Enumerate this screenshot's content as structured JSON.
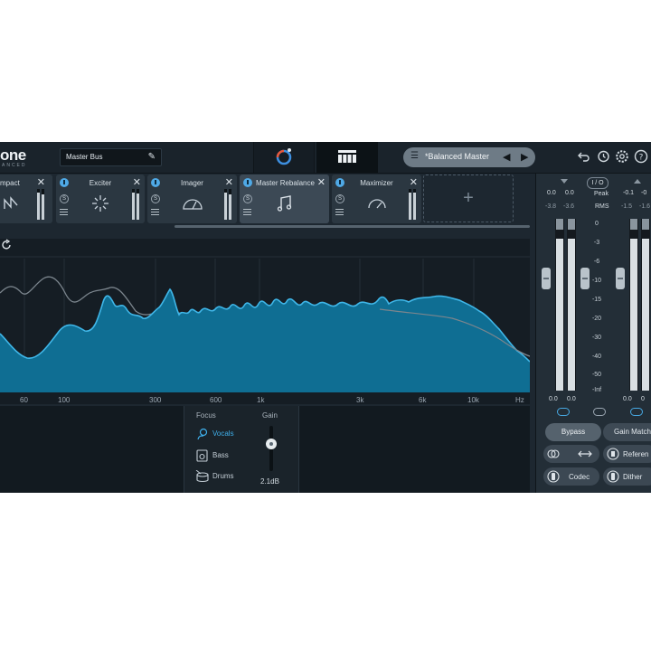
{
  "header": {
    "logo_text": "one",
    "logo_subtext": "ANCED",
    "preset_name": "Master Bus",
    "preset_selector": "*Balanced Master",
    "icons": [
      "edit-icon",
      "assistant-icon",
      "modules-grid-icon",
      "list-icon",
      "prev-icon",
      "next-icon",
      "undo-icon",
      "history-icon",
      "settings-icon",
      "help-icon"
    ]
  },
  "modules": [
    {
      "name": "mpact",
      "icon": "impact-icon"
    },
    {
      "name": "Exciter",
      "icon": "exciter-icon"
    },
    {
      "name": "Imager",
      "icon": "imager-icon"
    },
    {
      "name": "Master Rebalance",
      "icon": "rebalance-icon",
      "active": true
    },
    {
      "name": "Maximizer",
      "icon": "maximizer-icon"
    }
  ],
  "add_module": "+",
  "spectrum": {
    "freq_labels": [
      "60",
      "100",
      "300",
      "600",
      "1k",
      "3k",
      "6k",
      "10k",
      "Hz"
    ]
  },
  "rebalance": {
    "focus_label": "Focus",
    "gain_label": "Gain",
    "focus_options": [
      {
        "label": "Vocals",
        "selected": true
      },
      {
        "label": "Bass",
        "selected": false
      },
      {
        "label": "Drums",
        "selected": false
      }
    ],
    "gain_value": "2.1dB",
    "gain_fraction": 0.6
  },
  "meters": {
    "io_label": "I / O",
    "peak_label": "Peak",
    "rms_label": "RMS",
    "input_peak": [
      "0.0",
      "0.0"
    ],
    "input_rms": [
      "-3.8",
      "-3.6"
    ],
    "output_peak": [
      "-0.1",
      "-0"
    ],
    "output_rms": [
      "-1.5",
      "-1.6"
    ],
    "scale": [
      "0",
      "-3",
      "-6",
      "-10",
      "-15",
      "-20",
      "-30",
      "-40",
      "-50",
      "-Inf"
    ],
    "input_bottom": [
      "0.0",
      "0.0"
    ],
    "output_bottom": [
      "0.0",
      "0"
    ],
    "bypass": "Bypass",
    "gain_match": "Gain Match",
    "reference": "Referen",
    "codec": "Codec",
    "dither": "Dither"
  }
}
